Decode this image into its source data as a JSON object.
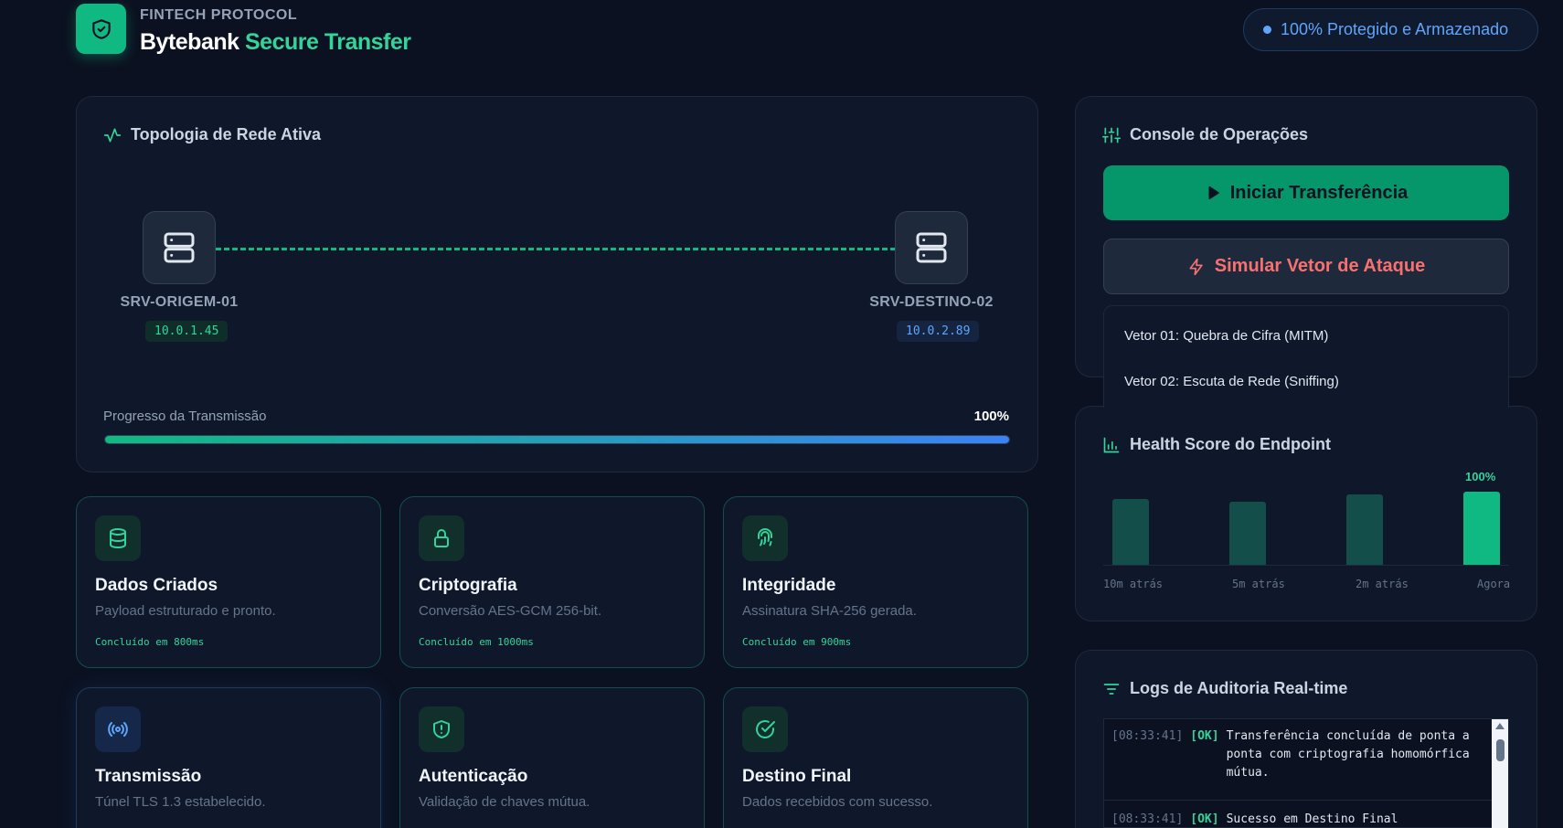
{
  "header": {
    "subtitle": "FINTECH PROTOCOL",
    "title_main": "Bytebank",
    "title_accent": "Secure Transfer",
    "status": "100% Protegido e Armazenado",
    "logo_icon": "shield-check-icon"
  },
  "topology": {
    "title": "Topologia de Rede Ativa",
    "origin": {
      "name": "SRV-ORIGEM-01",
      "ip": "10.0.1.45"
    },
    "destination": {
      "name": "SRV-DESTINO-02",
      "ip": "10.0.2.89"
    },
    "progress_label": "Progresso da Transmissão",
    "progress_value": "100%",
    "progress_fraction": 1.0
  },
  "cards": [
    {
      "title": "Dados Criados",
      "desc": "Payload estruturado e pronto.",
      "status": "Concluído em 800ms",
      "icon": "database-icon"
    },
    {
      "title": "Criptografia",
      "desc": "Conversão AES-GCM 256-bit.",
      "status": "Concluído em 1000ms",
      "icon": "lock-icon"
    },
    {
      "title": "Integridade",
      "desc": "Assinatura SHA-256 gerada.",
      "status": "Concluído em 900ms",
      "icon": "fingerprint-icon"
    },
    {
      "title": "Transmissão",
      "desc": "Túnel TLS 1.3 estabelecido.",
      "status": "",
      "icon": "broadcast-icon"
    },
    {
      "title": "Autenticação",
      "desc": "Validação de chaves mútua.",
      "status": "",
      "icon": "shield-alert-icon"
    },
    {
      "title": "Destino Final",
      "desc": "Dados recebidos com sucesso.",
      "status": "",
      "icon": "check-circle-icon"
    }
  ],
  "console": {
    "title": "Console de Operações",
    "start_label": "Iniciar Transferência",
    "attack_label": "Simular Vetor de Ataque",
    "attack_options": [
      "Vetor 01: Quebra de Cifra (MITM)",
      "Vetor 02: Escuta de Rede (Sniffing)"
    ]
  },
  "health": {
    "title": "Health Score do Endpoint",
    "current_label": "100%"
  },
  "chart_data": {
    "type": "bar",
    "categories": [
      "10m atrás",
      "5m atrás",
      "2m atrás",
      "Agora"
    ],
    "values": [
      90,
      86,
      96,
      100
    ],
    "ylim": [
      0,
      100
    ],
    "title": "",
    "xlabel": "",
    "ylabel": ""
  },
  "logs": {
    "title": "Logs de Auditoria Real-time",
    "entries": [
      {
        "time": "[08:33:41]",
        "tag": "[OK]",
        "msg": "Transferência concluída de ponta a ponta com criptografia homomórfica mútua."
      },
      {
        "time": "[08:33:41]",
        "tag": "[OK]",
        "msg": "Sucesso em Destino Final"
      }
    ]
  },
  "colors": {
    "accent": "#10b981",
    "info": "#60a5fa",
    "danger": "#f87171",
    "background": "#0b1120"
  }
}
